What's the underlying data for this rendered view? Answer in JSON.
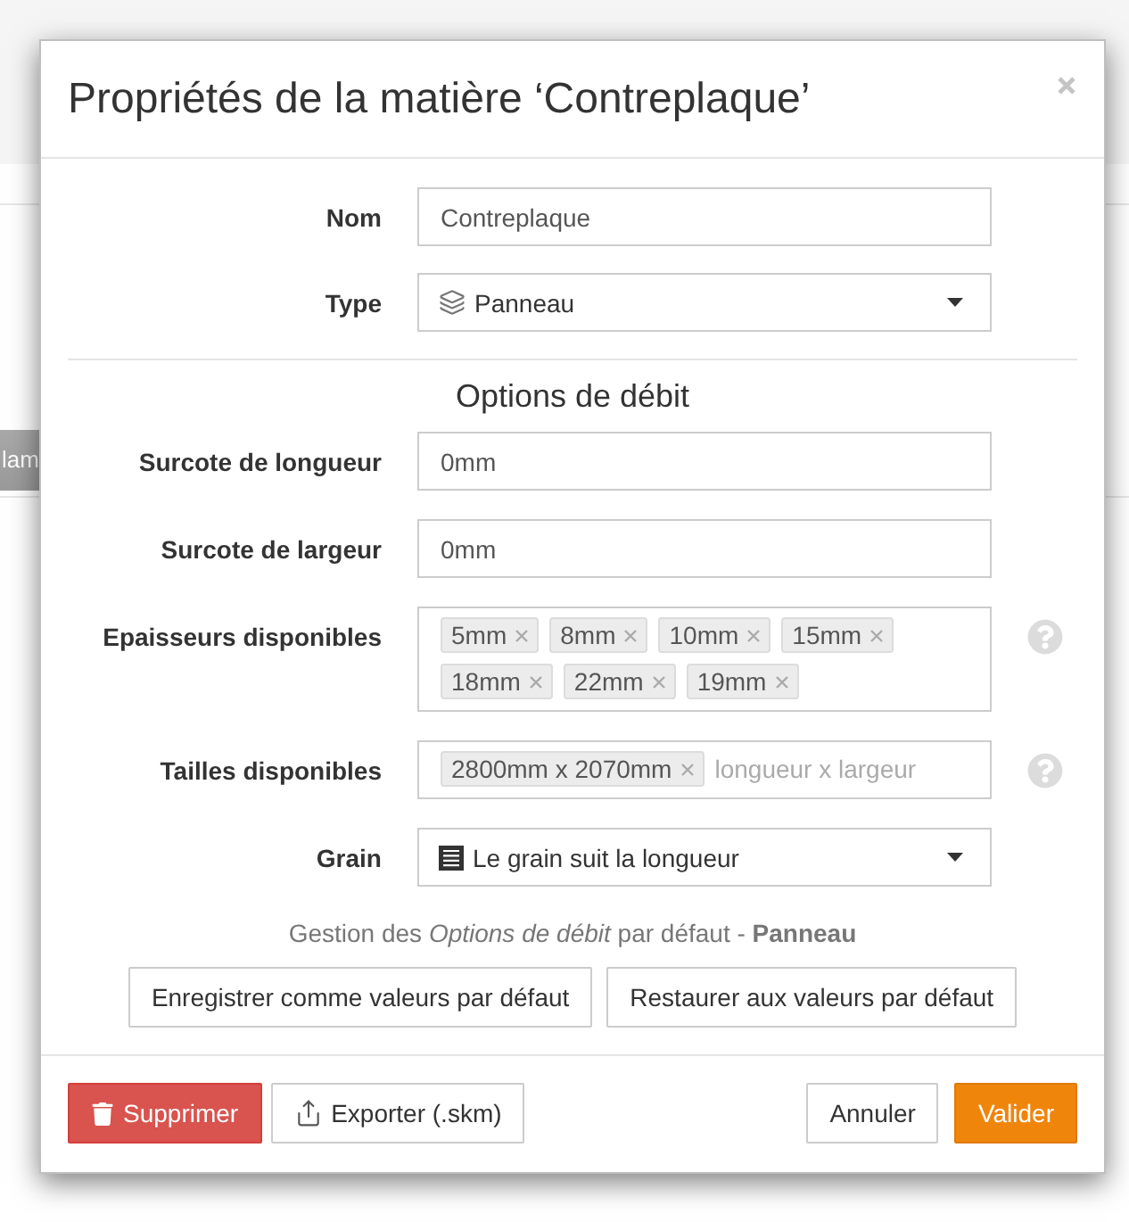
{
  "background": {
    "button_fragment": "lam"
  },
  "dialog": {
    "title": "Propriétés de la matière ‘Contreplaque’"
  },
  "name_field": {
    "label": "Nom",
    "value": "Contreplaque"
  },
  "type_select": {
    "label": "Type",
    "value": "Panneau"
  },
  "cut_options": {
    "title": "Options de débit",
    "length_margin": {
      "label": "Surcote de longueur",
      "value": "0mm"
    },
    "width_margin": {
      "label": "Surcote de largeur",
      "value": "0mm"
    },
    "thicknesses": {
      "label": "Epaisseurs disponibles",
      "tags": [
        "5mm",
        "8mm",
        "10mm",
        "15mm",
        "18mm",
        "22mm",
        "19mm"
      ]
    },
    "sizes": {
      "label": "Tailles disponibles",
      "tags": [
        "2800mm x 2070mm"
      ],
      "placeholder": "longueur x largeur"
    },
    "grain_select": {
      "label": "Grain",
      "value": "Le grain suit la longueur"
    },
    "defaults_note": "Gestion des *Options de débit* par défaut - **Panneau**",
    "defaults_buttons": [
      "Enregistrer comme valeurs par défaut",
      "Restaurer aux valeurs par défaut"
    ]
  },
  "footer": {
    "left": [
      {
        "kind": "danger",
        "label": "Supprimer"
      },
      {
        "kind": "export",
        "label": "Exporter (.skm)"
      }
    ],
    "right": [
      {
        "kind": "default",
        "label": "Annuler"
      },
      {
        "kind": "primary",
        "label": "Valider"
      }
    ]
  }
}
